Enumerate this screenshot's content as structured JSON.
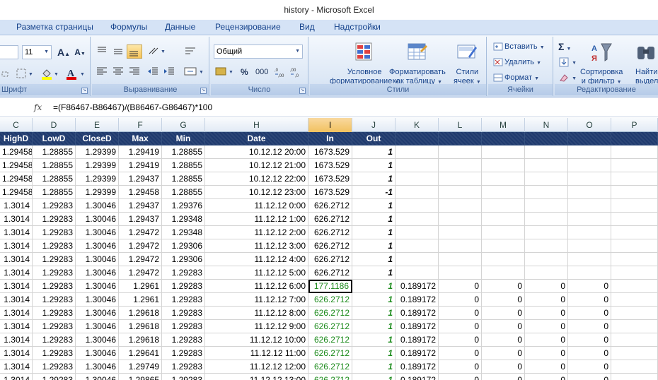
{
  "window": {
    "title": "history - Microsoft Excel"
  },
  "tabs": [
    "Разметка страницы",
    "Формулы",
    "Данные",
    "Рецензирование",
    "Вид",
    "Надстройки"
  ],
  "ribbon": {
    "font_group": {
      "label": "Шрифт",
      "font_size": "11"
    },
    "alignment_group": {
      "label": "Выравнивание"
    },
    "number_group": {
      "label": "Число",
      "format": "Общий",
      "percent": "%",
      "thousands": "000"
    },
    "styles_group": {
      "label": "Стили",
      "cond_format": [
        "Условное",
        "форматирование"
      ],
      "format_table": [
        "Форматировать",
        "как таблицу"
      ],
      "cell_styles": [
        "Стили",
        "ячеек"
      ]
    },
    "cells_group": {
      "label": "Ячейки",
      "insert": "Вставить",
      "delete": "Удалить",
      "format": "Формат"
    },
    "editing_group": {
      "label": "Редактирование",
      "sort": [
        "Сортировка",
        "и фильтр"
      ],
      "find": [
        "Найти",
        "выдели"
      ]
    }
  },
  "formula_bar": {
    "fx": "fx",
    "formula": "=(F86467-B86467)/(B86467-G86467)*100"
  },
  "columns": [
    "C",
    "D",
    "E",
    "F",
    "G",
    "H",
    "I",
    "J",
    "K",
    "L",
    "M",
    "N",
    "O",
    "P"
  ],
  "selected_column": "I",
  "header_row": [
    "HighD",
    "LowD",
    "CloseD",
    "Max",
    "Min",
    "Date",
    "In",
    "Out",
    "",
    "",
    "",
    "",
    "",
    ""
  ],
  "rows": [
    [
      "1.29458",
      "1.28855",
      "1.29399",
      "1.29419",
      "1.28855",
      "10.12.12 20:00",
      "1673.529",
      "1",
      "",
      "",
      "",
      "",
      "",
      ""
    ],
    [
      "1.29458",
      "1.28855",
      "1.29399",
      "1.29419",
      "1.28855",
      "10.12.12 21:00",
      "1673.529",
      "1",
      "",
      "",
      "",
      "",
      "",
      ""
    ],
    [
      "1.29458",
      "1.28855",
      "1.29399",
      "1.29437",
      "1.28855",
      "10.12.12 22:00",
      "1673.529",
      "1",
      "",
      "",
      "",
      "",
      "",
      ""
    ],
    [
      "1.29458",
      "1.28855",
      "1.29399",
      "1.29458",
      "1.28855",
      "10.12.12 23:00",
      "1673.529",
      "-1",
      "",
      "",
      "",
      "",
      "",
      ""
    ],
    [
      "1.3014",
      "1.29283",
      "1.30046",
      "1.29437",
      "1.29376",
      "11.12.12 0:00",
      "626.2712",
      "1",
      "",
      "",
      "",
      "",
      "",
      ""
    ],
    [
      "1.3014",
      "1.29283",
      "1.30046",
      "1.29437",
      "1.29348",
      "11.12.12 1:00",
      "626.2712",
      "1",
      "",
      "",
      "",
      "",
      "",
      ""
    ],
    [
      "1.3014",
      "1.29283",
      "1.30046",
      "1.29472",
      "1.29348",
      "11.12.12 2:00",
      "626.2712",
      "1",
      "",
      "",
      "",
      "",
      "",
      ""
    ],
    [
      "1.3014",
      "1.29283",
      "1.30046",
      "1.29472",
      "1.29306",
      "11.12.12 3:00",
      "626.2712",
      "1",
      "",
      "",
      "",
      "",
      "",
      ""
    ],
    [
      "1.3014",
      "1.29283",
      "1.30046",
      "1.29472",
      "1.29306",
      "11.12.12 4:00",
      "626.2712",
      "1",
      "",
      "",
      "",
      "",
      "",
      ""
    ],
    [
      "1.3014",
      "1.29283",
      "1.30046",
      "1.29472",
      "1.29283",
      "11.12.12 5:00",
      "626.2712",
      "1",
      "",
      "",
      "",
      "",
      "",
      ""
    ],
    [
      "1.3014",
      "1.29283",
      "1.30046",
      "1.2961",
      "1.29283",
      "11.12.12 6:00",
      "177.1186",
      "1",
      "0.189172",
      "0",
      "0",
      "0",
      "0",
      ""
    ],
    [
      "1.3014",
      "1.29283",
      "1.30046",
      "1.2961",
      "1.29283",
      "11.12.12 7:00",
      "626.2712",
      "1",
      "0.189172",
      "0",
      "0",
      "0",
      "0",
      ""
    ],
    [
      "1.3014",
      "1.29283",
      "1.30046",
      "1.29618",
      "1.29283",
      "11.12.12 8:00",
      "626.2712",
      "1",
      "0.189172",
      "0",
      "0",
      "0",
      "0",
      ""
    ],
    [
      "1.3014",
      "1.29283",
      "1.30046",
      "1.29618",
      "1.29283",
      "11.12.12 9:00",
      "626.2712",
      "1",
      "0.189172",
      "0",
      "0",
      "0",
      "0",
      ""
    ],
    [
      "1.3014",
      "1.29283",
      "1.30046",
      "1.29618",
      "1.29283",
      "11.12.12 10:00",
      "626.2712",
      "1",
      "0.189172",
      "0",
      "0",
      "0",
      "0",
      ""
    ],
    [
      "1.3014",
      "1.29283",
      "1.30046",
      "1.29641",
      "1.29283",
      "11.12.12 11:00",
      "626.2712",
      "1",
      "0.189172",
      "0",
      "0",
      "0",
      "0",
      ""
    ],
    [
      "1.3014",
      "1.29283",
      "1.30046",
      "1.29749",
      "1.29283",
      "11.12.12 12:00",
      "626.2712",
      "1",
      "0.189172",
      "0",
      "0",
      "0",
      "0",
      ""
    ],
    [
      "1.3014",
      "1.29283",
      "1.30046",
      "1.29865",
      "1.29283",
      "11.12.12 13:00",
      "626.2712",
      "1",
      "0.189172",
      "0",
      "0",
      "0",
      "0",
      ""
    ]
  ],
  "colors": {
    "header_bg": "#1f3a6e",
    "green_text": "#1a8a1a",
    "selected_col": "#f1c15f"
  }
}
